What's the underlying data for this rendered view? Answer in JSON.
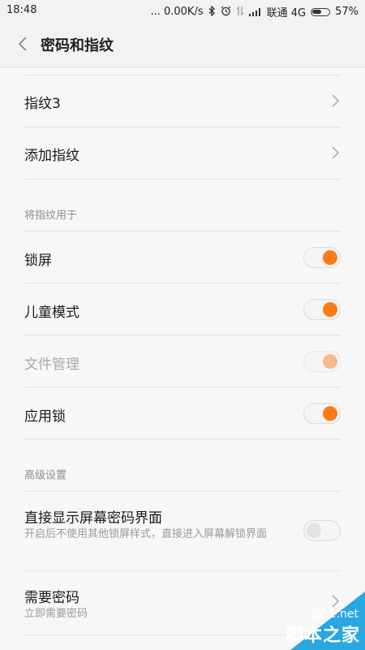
{
  "status_bar": {
    "time": "18:48",
    "network_speed": "... 0.00K/s",
    "carrier": "联通 4G",
    "battery_percent": "57%",
    "battery_level": 0.57,
    "icons": [
      "bluetooth-icon",
      "alarm-icon",
      "data-arrows-icon",
      "signal-icon",
      "battery-icon"
    ]
  },
  "header": {
    "title": "密码和指纹",
    "back_icon": "chevron-left-icon"
  },
  "fingerprints": [
    {
      "label": "指纹3"
    },
    {
      "label": "添加指纹"
    }
  ],
  "use_fingerprint_section": {
    "header": "将指纹用于",
    "items": [
      {
        "label": "锁屏",
        "state": "on",
        "enabled": true
      },
      {
        "label": "儿童模式",
        "state": "on",
        "enabled": true
      },
      {
        "label": "文件管理",
        "state": "on",
        "enabled": false
      },
      {
        "label": "应用锁",
        "state": "on",
        "enabled": true
      }
    ]
  },
  "advanced_section": {
    "header": "高级设置",
    "direct_display": {
      "title": "直接显示屏幕密码界面",
      "subtitle": "开启后不使用其他锁屏样式，直接进入屏幕解锁界面",
      "state": "off"
    },
    "require_password": {
      "title": "需要密码",
      "subtitle": "立即需要密码"
    }
  },
  "watermark": {
    "site": "jb51.net",
    "brand": "脚本之家"
  },
  "colors": {
    "accent": "#ff7a14",
    "accent_disabled": "#f8b98a",
    "watermark_blue": "#29a7e1"
  }
}
